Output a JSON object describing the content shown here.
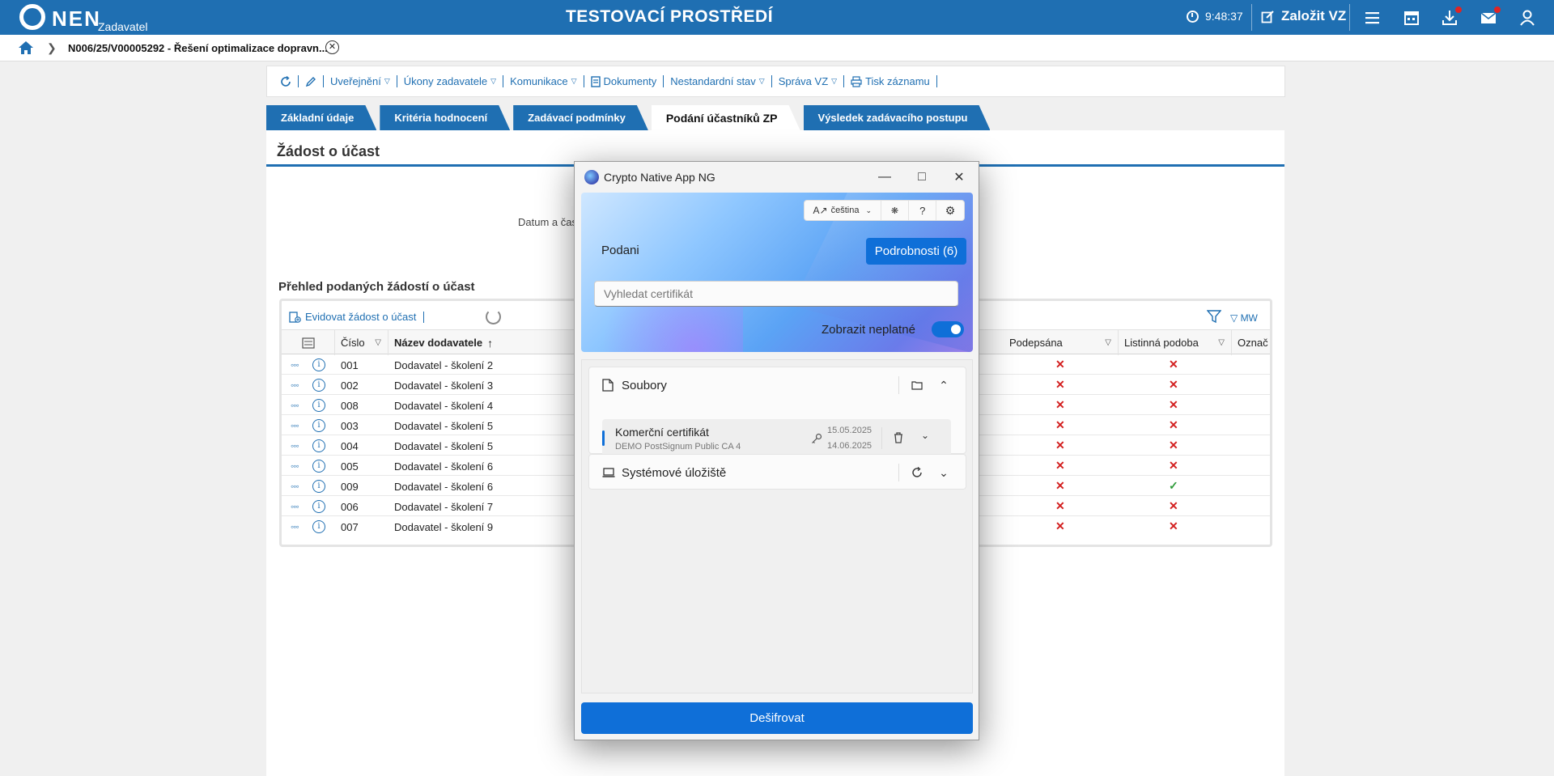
{
  "topbar": {
    "logo": "NEN",
    "logo_sub": "Zadavatel",
    "environment": "TESTOVACÍ PROSTŘEDÍ",
    "clock": "9:48:37",
    "create_vz": "Založit VZ",
    "accent": "#1f6fb2"
  },
  "breadcrumb": {
    "item": "N006/25/V00005292 - Řešení optimalizace dopravn..."
  },
  "toolbar": {
    "items": [
      "Uveřejnění",
      "Úkony zadavatele",
      "Komunikace",
      "Dokumenty",
      "Nestandardní stav",
      "Správa VZ",
      "Tisk záznamu"
    ]
  },
  "tabs": [
    "Základní údaje",
    "Kritéria hodnocení",
    "Zadávací podmínky",
    "Podání účastníků ZP",
    "Výsledek zadávacího postupu"
  ],
  "active_tab": "Podání účastníků ZP",
  "section": {
    "title": "Žádost o účast",
    "datum_label": "Datum a čas",
    "overview_title": "Přehled podaných žádostí o účast",
    "evidovat": "Evidovat žádost o účast",
    "mw": "MW"
  },
  "grid": {
    "columns": [
      "Číslo",
      "Název dodavatele",
      "Podepsána",
      "Listinná podoba",
      "Označ"
    ],
    "rows": [
      {
        "cislo": "001",
        "nazev": "Dodavatel - školení 2",
        "podepsana": "✕",
        "listinna": "✕"
      },
      {
        "cislo": "002",
        "nazev": "Dodavatel - školení 3",
        "podepsana": "✕",
        "listinna": "✕"
      },
      {
        "cislo": "008",
        "nazev": "Dodavatel - školení 4",
        "podepsana": "✕",
        "listinna": "✕"
      },
      {
        "cislo": "003",
        "nazev": "Dodavatel - školení 5",
        "podepsana": "✕",
        "listinna": "✕"
      },
      {
        "cislo": "004",
        "nazev": "Dodavatel - školení 5",
        "podepsana": "✕",
        "listinna": "✕"
      },
      {
        "cislo": "005",
        "nazev": "Dodavatel - školení 6",
        "podepsana": "✕",
        "listinna": "✕"
      },
      {
        "cislo": "009",
        "nazev": "Dodavatel - školení 6",
        "podepsana": "✕",
        "listinna": "✓"
      },
      {
        "cislo": "006",
        "nazev": "Dodavatel - školení 7",
        "podepsana": "✕",
        "listinna": "✕"
      },
      {
        "cislo": "007",
        "nazev": "Dodavatel - školení 9",
        "podepsana": "✕",
        "listinna": "✕"
      }
    ]
  },
  "dialog": {
    "title": "Crypto Native App NG",
    "language": "čeština",
    "podani_label": "Podani",
    "details_button": "Podrobnosti (6)",
    "search_placeholder": "Vyhledat certifikát",
    "show_invalid_label": "Zobrazit neplatné",
    "show_invalid": true,
    "files_panel": "Soubory",
    "certificate": {
      "name": "Komerční certifikát",
      "issuer": "DEMO PostSignum Public CA 4",
      "valid_from": "15.05.2025",
      "valid_to": "14.06.2025"
    },
    "system_store_panel": "Systémové úložiště",
    "decrypt_button": "Dešifrovat",
    "accent": "#0f6fd8"
  }
}
